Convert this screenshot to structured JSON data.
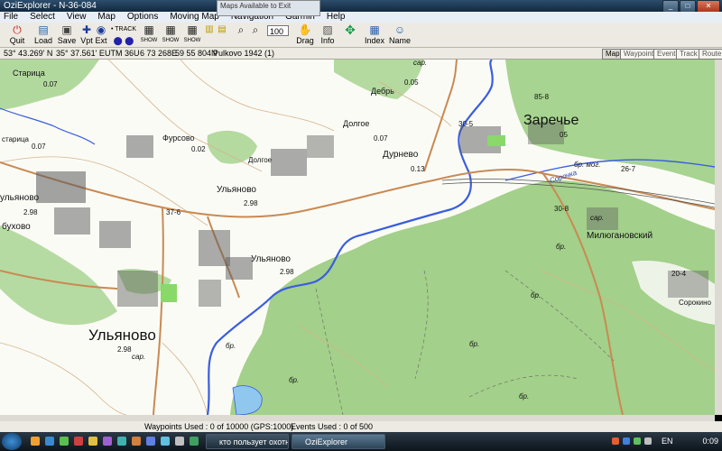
{
  "window": {
    "title": "OziExplorer - N-36-084"
  },
  "popup_text": "Maps Available to Exit",
  "menu": [
    "File",
    "Select",
    "View",
    "Map",
    "Options",
    "Moving Map",
    "Navigation",
    "Garmin",
    "Help"
  ],
  "toolbar": {
    "quit": "Quit",
    "load": "Load",
    "save": "Save",
    "vpt": "Vpt",
    "ext": "Ext",
    "show1": "SHOW",
    "show2": "SHOW",
    "show3": "SHOW",
    "zoom_value": "100",
    "drag": "Drag",
    "info": "Info",
    "index": "Index",
    "name": "Name",
    "track_label": "TRACK"
  },
  "status": {
    "lat": "53° 43.269' N",
    "lon": "35° 37.561' E",
    "utm": "UTM  36U",
    "easting": "6 73 268E",
    "northing": "59 55 804N",
    "datum": "Pulkovo 1942 (1)"
  },
  "modes": [
    "Map",
    "Waypoint",
    "Event",
    "Track",
    "Route"
  ],
  "map_labels": {
    "staritsa_top": "Старица",
    "staritsa_left": "старица",
    "val_007_a": "0.07",
    "val_007_b": "0.07",
    "val_007_c": "0.07",
    "debr": "Дебрь",
    "val_005": "0.05",
    "sar_top": "сар.",
    "value_858": "85-8",
    "zarechye": "Заречье",
    "val_05": "05",
    "dolgoe_a": "Долгое",
    "dolgoe_b": "Долгое",
    "furovo": "Фурсово",
    "val_002": "0.02",
    "durnevo": "Дурнево",
    "val_013": "0.13",
    "val_305": "30-5",
    "ulyanovo_top": "Ульяново",
    "val_298_a": "2.98",
    "val_376": "37-6",
    "bobukhovo": "бухово",
    "val_298_b": "2.98",
    "sorochka": "Сорочка",
    "br_mog": "бр. мог.",
    "val_267": "26-7",
    "val_308": "30-8",
    "sar_mid": "сар.",
    "milyuganovskiy": "Милюгановский",
    "ulyanovo_mid": "Ульяново",
    "val_298_c": "2.98",
    "ulyanovo_main": "Ульяново",
    "val_298_d": "2.98",
    "sar_main": "сар.",
    "val_204": "20-4",
    "sorokino": "Сорокино",
    "ulyanovo_left": "ульяново",
    "br_a": "бр.",
    "br_b": "бр.",
    "br_c": "бр.",
    "br_d": "бр.",
    "br_e": "бр.",
    "br_f": "бр."
  },
  "info": {
    "waypoints": "Waypoints Used : 0 of 10000  (GPS:1000)",
    "events": "Events Used : 0 of 500"
  },
  "taskbar": {
    "task1": "кто пользует охотн...",
    "task2": "OziExplorer",
    "lang": "EN",
    "time": "0:09"
  }
}
